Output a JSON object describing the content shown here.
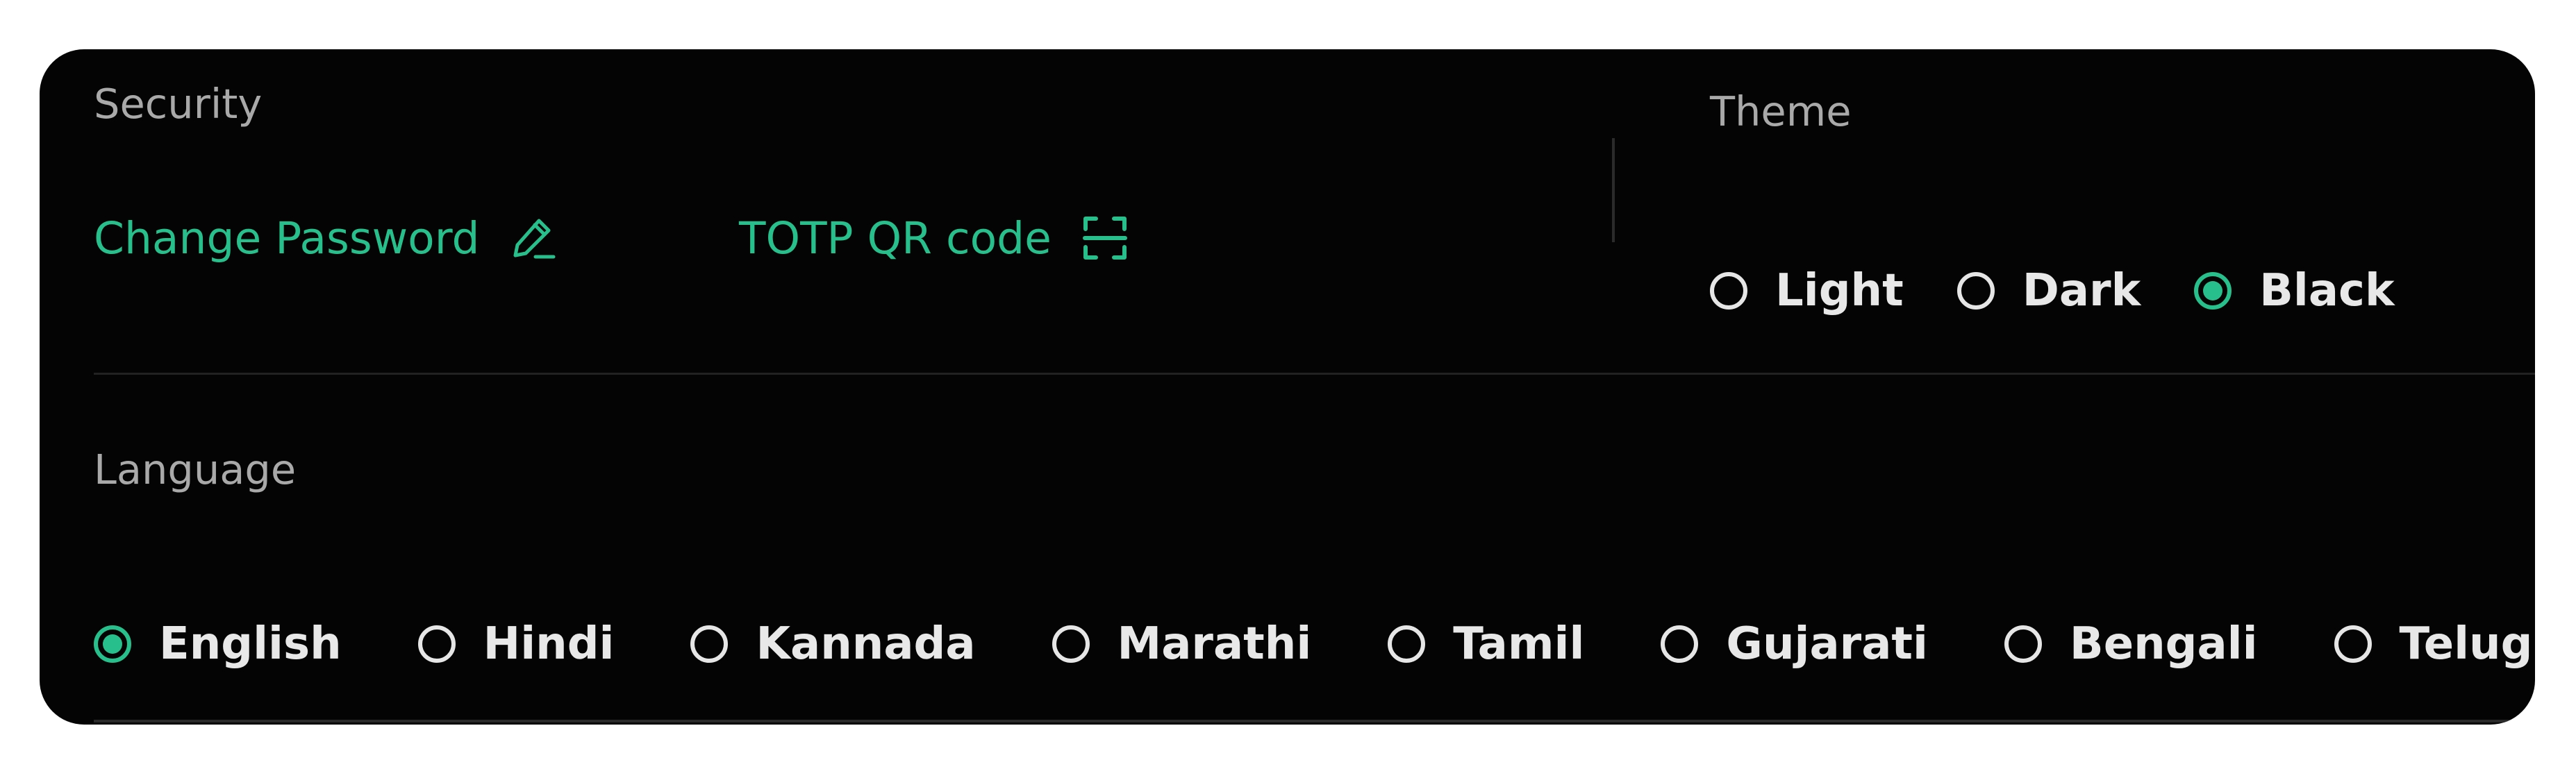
{
  "security": {
    "label": "Security",
    "change_password": "Change Password",
    "totp_qr_code": "TOTP QR code"
  },
  "theme": {
    "label": "Theme",
    "options": [
      "Light",
      "Dark",
      "Black"
    ],
    "selected": "Black"
  },
  "language": {
    "label": "Language",
    "options": [
      "English",
      "Hindi",
      "Kannada",
      "Marathi",
      "Tamil",
      "Gujarati",
      "Bengali",
      "Telugu"
    ],
    "selected": "English"
  },
  "colors": {
    "accent": "#27c08c",
    "panel_background": "#040404",
    "label_text": "#a9a9a9",
    "option_text": "#e8e8e8"
  },
  "icons": {
    "change_password": "pencil-icon",
    "totp_qr_code": "scan-frame-icon"
  }
}
